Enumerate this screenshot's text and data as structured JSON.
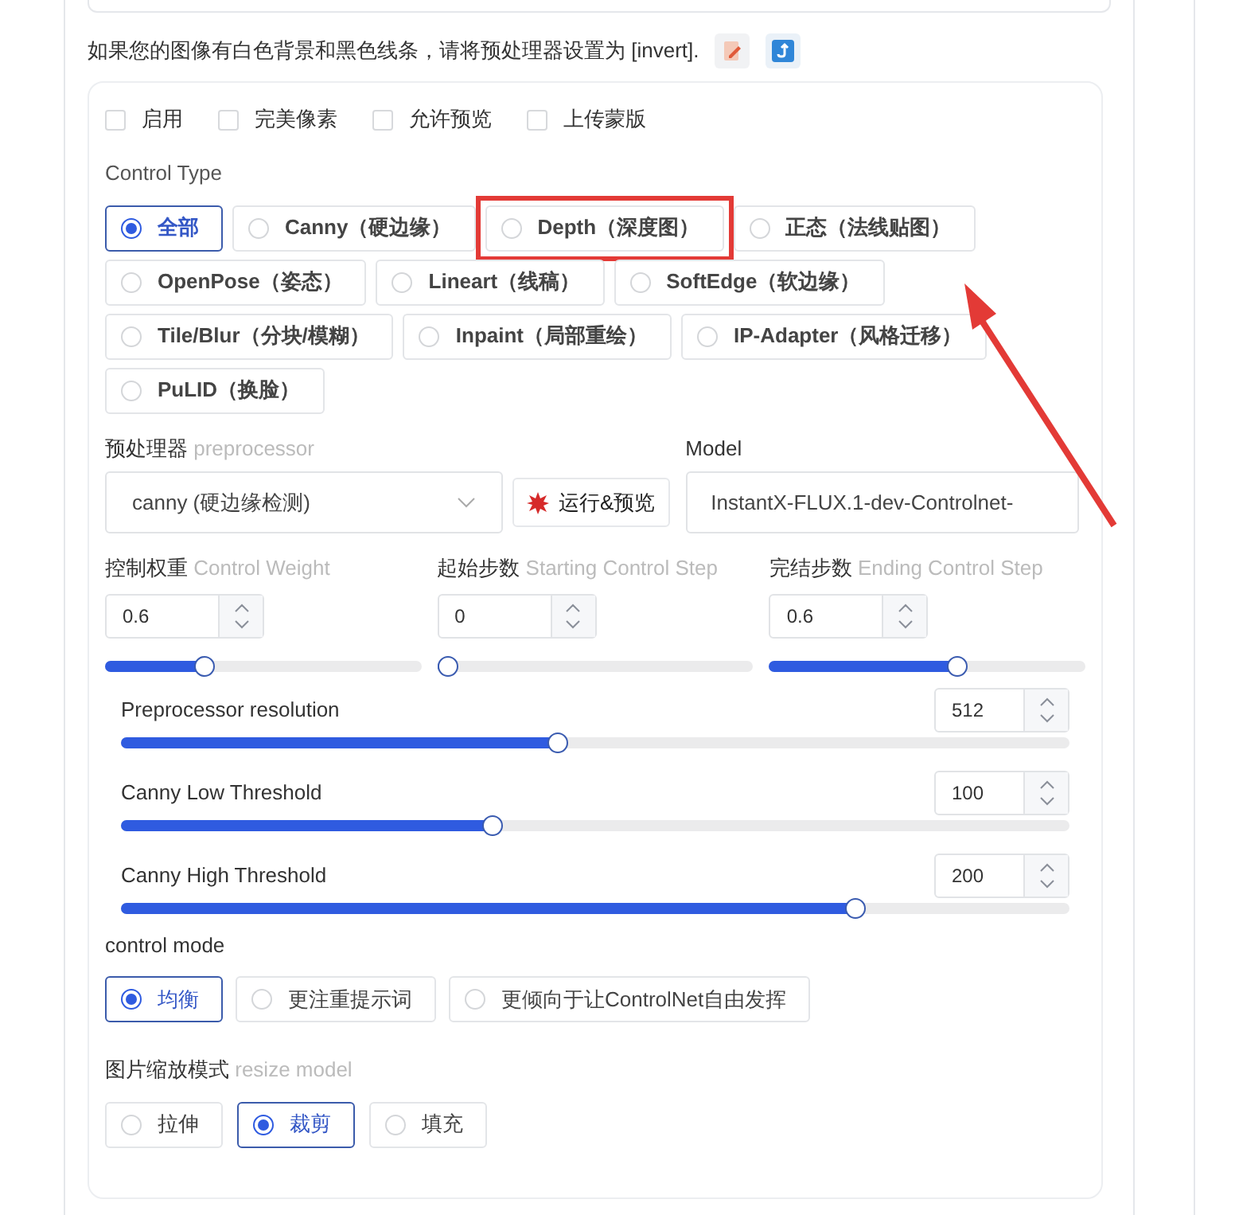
{
  "hint": {
    "text": "如果您的图像有白色背景和黑色线条，请将预处理器设置为 [invert]."
  },
  "checkboxes": [
    {
      "label": "启用",
      "checked": false
    },
    {
      "label": "完美像素",
      "checked": false
    },
    {
      "label": "允许预览",
      "checked": false
    },
    {
      "label": "上传蒙版",
      "checked": false
    }
  ],
  "control_type": {
    "label": "Control Type",
    "options": [
      {
        "label": "全部",
        "selected": true,
        "highlighted": false
      },
      {
        "label": "Canny（硬边缘）",
        "selected": false,
        "highlighted": false
      },
      {
        "label": "Depth（深度图）",
        "selected": false,
        "highlighted": true
      },
      {
        "label": "正态（法线贴图）",
        "selected": false,
        "highlighted": false
      },
      {
        "label": "OpenPose（姿态）",
        "selected": false,
        "highlighted": false
      },
      {
        "label": "Lineart（线稿）",
        "selected": false,
        "highlighted": false
      },
      {
        "label": "SoftEdge（软边缘）",
        "selected": false,
        "highlighted": false
      },
      {
        "label": "Tile/Blur（分块/模糊）",
        "selected": false,
        "highlighted": false
      },
      {
        "label": "Inpaint（局部重绘）",
        "selected": false,
        "highlighted": false
      },
      {
        "label": "IP-Adapter（风格迁移）",
        "selected": false,
        "highlighted": false
      },
      {
        "label": "PuLID（换脸）",
        "selected": false,
        "highlighted": false
      }
    ]
  },
  "preprocessor": {
    "label": "预处理器",
    "sublabel": "preprocessor",
    "value": "canny (硬边缘检测)"
  },
  "run_button": {
    "label": "运行&预览"
  },
  "model": {
    "label": "Model",
    "value": "InstantX-FLUX.1-dev-Controlnet-"
  },
  "step_controls": [
    {
      "label": "控制权重",
      "sublabel": "Control Weight",
      "value": "0.6",
      "level": 0.3
    },
    {
      "label": "起始步数",
      "sublabel": "Starting Control Step",
      "value": "0",
      "level": 0
    },
    {
      "label": "完结步数",
      "sublabel": "Ending Control Step",
      "value": "0.6",
      "level": 0.6
    }
  ],
  "sliders": [
    {
      "label": "Preprocessor resolution",
      "value": "512",
      "level": 0.46
    },
    {
      "label": "Canny Low Threshold",
      "value": "100",
      "level": 0.39
    },
    {
      "label": "Canny High Threshold",
      "value": "200",
      "level": 0.78
    }
  ],
  "control_mode": {
    "label": "control mode",
    "options": [
      {
        "label": "均衡",
        "selected": true
      },
      {
        "label": "更注重提示词",
        "selected": false
      },
      {
        "label": "更倾向于让ControlNet自由发挥",
        "selected": false
      }
    ]
  },
  "resize_mode": {
    "label": "图片缩放模式",
    "sublabel": "resize model",
    "options": [
      {
        "label": "拉伸",
        "selected": false
      },
      {
        "label": "裁剪",
        "selected": true
      },
      {
        "label": "填充",
        "selected": false
      }
    ]
  }
}
